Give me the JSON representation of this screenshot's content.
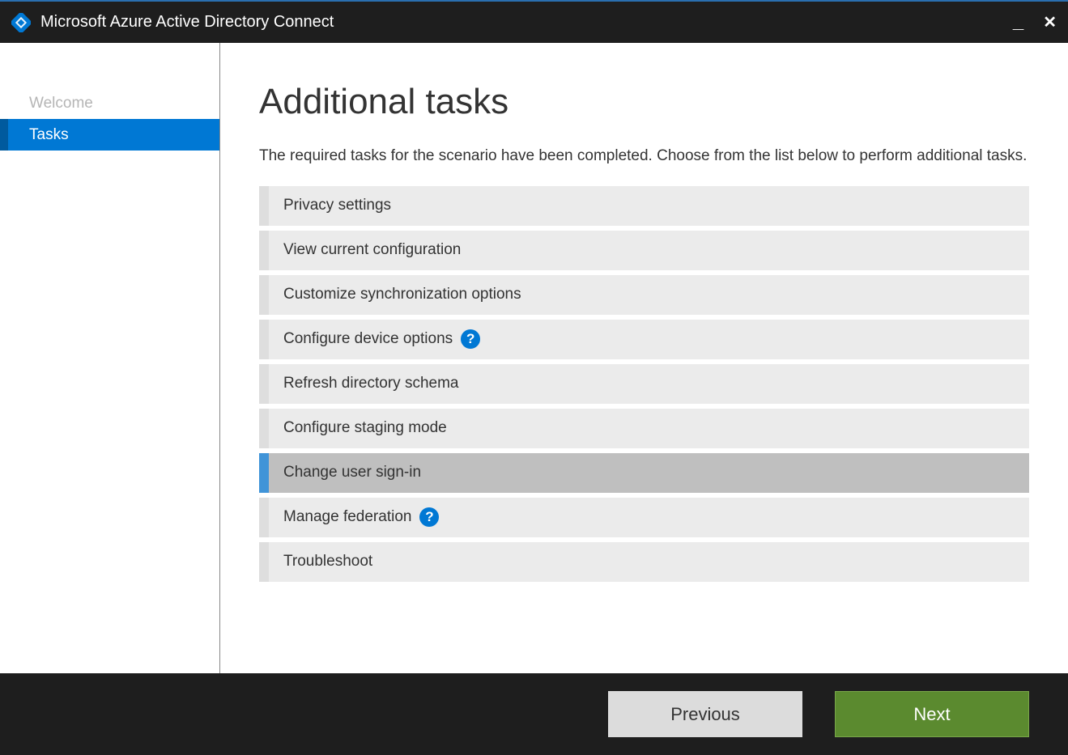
{
  "titlebar": {
    "app_title": "Microsoft Azure Active Directory Connect"
  },
  "sidebar": {
    "items": [
      {
        "label": "Welcome",
        "state": "completed"
      },
      {
        "label": "Tasks",
        "state": "active"
      }
    ]
  },
  "main": {
    "title": "Additional tasks",
    "description": "The required tasks for the scenario have been completed. Choose from the list below to perform additional tasks.",
    "tasks": [
      {
        "label": "Privacy settings",
        "help": false,
        "selected": false
      },
      {
        "label": "View current configuration",
        "help": false,
        "selected": false
      },
      {
        "label": "Customize synchronization options",
        "help": false,
        "selected": false
      },
      {
        "label": "Configure device options",
        "help": true,
        "selected": false
      },
      {
        "label": "Refresh directory schema",
        "help": false,
        "selected": false
      },
      {
        "label": "Configure staging mode",
        "help": false,
        "selected": false
      },
      {
        "label": "Change user sign-in",
        "help": false,
        "selected": true
      },
      {
        "label": "Manage federation",
        "help": true,
        "selected": false
      },
      {
        "label": "Troubleshoot",
        "help": false,
        "selected": false
      }
    ]
  },
  "footer": {
    "previous_label": "Previous",
    "next_label": "Next"
  }
}
